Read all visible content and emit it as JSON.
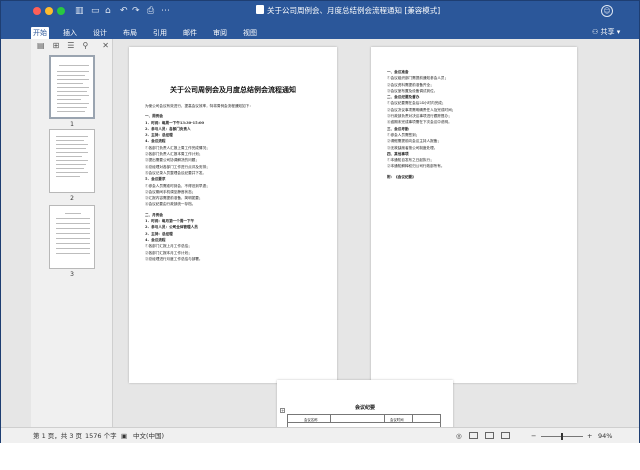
{
  "window": {
    "title": "关于公司周例会、月度总结例会流程通知 [兼容模式]"
  },
  "quick_access": {
    "icons": [
      "sidebar-icon",
      "save-icon",
      "home-icon",
      "undo-icon",
      "redo-icon",
      "print-icon",
      "more-icon"
    ],
    "glyphs": [
      "▥",
      "▭",
      "⌂",
      "↶",
      "↷",
      "⎙",
      "⋯"
    ]
  },
  "menu": {
    "items": [
      "开始",
      "插入",
      "设计",
      "布局",
      "引用",
      "邮件",
      "审阅",
      "视图"
    ],
    "active_index": 0
  },
  "share_label": "共享",
  "nav_pane": {
    "tool_glyphs": [
      "▤",
      "⊞",
      "☰",
      "⚲"
    ],
    "page_numbers": [
      "1",
      "2",
      "3"
    ]
  },
  "document": {
    "title": "关于公司周例会及月度总结例会流程通知",
    "page1_lines": [
      "为使公司会议有效进行，提高会议效率，特将周例会流程通知如下：",
      "",
      "一、周例会",
      "1．时间：每周一下午13:30-15:00",
      "2．参与人员：各部门负责人",
      "3．主持：总经理",
      "4．会议流程",
      "①各部门负责人汇报上周工作完成情况；",
      "②各部门负责人汇报本周工作计划；",
      "③提出需要公司协调解决的问题；",
      "④总经理对各部门工作进行点评及安排；",
      "⑤会议记录人员整理会议纪要并下发。",
      "5．会议要求",
      "①参会人员需准时到会，不得迟到早退；",
      "②会议期间手机调至静音状态；",
      "③汇报内容需提前准备，简明扼要；",
      "④会议纪要由行政部统一存档。",
      "",
      "二、月例会",
      "1．时间：每月第一个周一下午",
      "2．参与人员：公司全体管理人员",
      "3．主持：总经理",
      "4．会议流程",
      "①各部门汇报上月工作总结；",
      "②各部门汇报本月工作计划；",
      "③总经理进行月度工作总结与部署。"
    ],
    "page2_lines": [
      "一、会议准备",
      "①会议组织部门需提前通知参会人员；",
      "②会议资料需提前准备齐全；",
      "③会议室布置及设备调试到位。",
      "二、会议纪要及督办",
      "①会议纪要需在会后24小时内完成；",
      "②会议决议事项需明确责任人及完成时间；",
      "③行政部负责对决议事项进行跟踪督办；",
      "④逾期未完成事项需在下次会议中说明。",
      "三、会议考勤",
      "①参会人员需签到；",
      "②请假需提前向会议主持人报备；",
      "③无故缺席者按公司制度处理。",
      "四、其他事项",
      "①本通知自发布之日起执行；",
      "②本通知解释权归公司行政部所有。",
      "",
      "附：《会议纪要》"
    ],
    "page3_title": "会议纪要",
    "page3_table_cells": [
      "会议名称",
      "会议时间"
    ]
  },
  "status_bar": {
    "page_info": "第 1 页，共 3 页",
    "word_count": "1576 个字",
    "language": "中文(中国)",
    "zoom": "94%",
    "zoom_level": 0.94
  },
  "colors": {
    "titlebar": "#2b579a",
    "canvas": "#e6e6e6",
    "nav_pane": "#f0f0f0"
  }
}
